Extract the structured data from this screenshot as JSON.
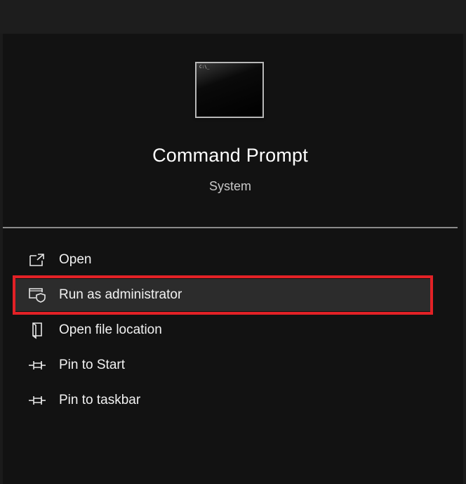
{
  "app": {
    "title": "Command Prompt",
    "subtitle": "System",
    "icon": "command-prompt-icon",
    "icon_glyph": "C:\\_"
  },
  "menu": {
    "items": [
      {
        "label": "Open",
        "icon": "open-external-icon"
      },
      {
        "label": "Run as administrator",
        "icon": "shield-window-icon",
        "highlighted": true
      },
      {
        "label": "Open file location",
        "icon": "file-location-icon"
      },
      {
        "label": "Pin to Start",
        "icon": "pin-icon"
      },
      {
        "label": "Pin to taskbar",
        "icon": "pin-icon"
      }
    ]
  },
  "colors": {
    "panel_background": "#121212",
    "highlight_border": "#e32126",
    "text_primary": "#ffffff",
    "text_secondary": "#c8c8c8"
  }
}
